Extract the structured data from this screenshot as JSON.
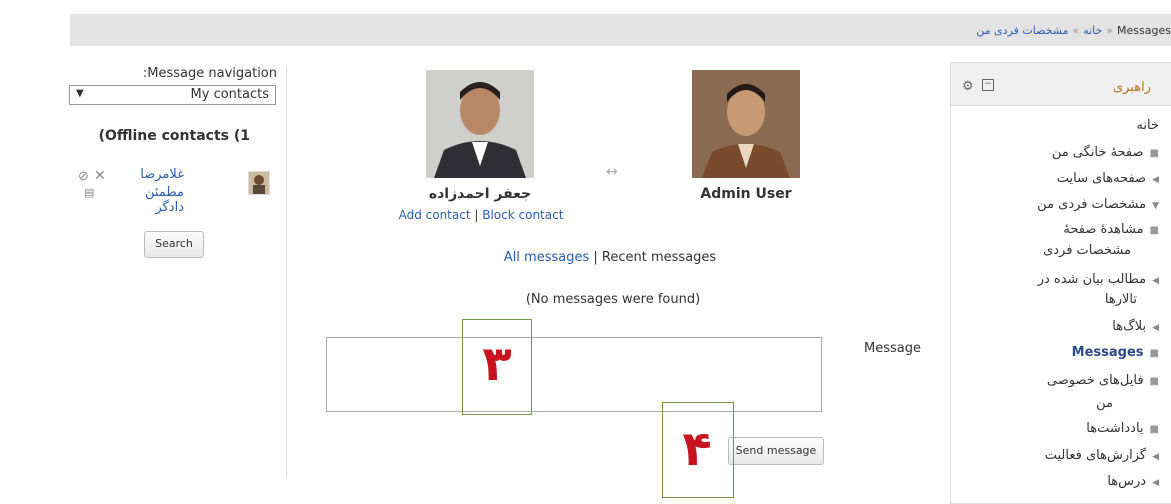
{
  "breadcrumb": {
    "items": [
      "خانه",
      "مشخصات فردی من",
      "Messages"
    ],
    "separator": "»"
  },
  "left_nav": {
    "title": ":Message navigation",
    "select_value": "My contacts",
    "offline_title": "(Offline contacts (1",
    "contact": {
      "name_line1": "غلامرضا",
      "name_line2": "مطمئن دادگر"
    },
    "search_button": "Search"
  },
  "center": {
    "user_jafar": "جعفر احمدزاده",
    "actions": {
      "add": "Add contact",
      "sep": "|",
      "block": "Block contact"
    },
    "user_admin": "Admin User",
    "links": {
      "all": "All messages",
      "sep": "|",
      "recent": "Recent messages"
    },
    "no_messages": "(No messages were found)",
    "message_label": "Message",
    "send_button": "Send message",
    "annotations": [
      "۳",
      "۴"
    ]
  },
  "block": {
    "title": "راهبری",
    "items": [
      "خانه",
      "صفحهٔ خانگی من",
      "صفحه‌های سایت",
      "مشخصات فردی من",
      "مشاهدهٔ صفحهٔ",
      "مشخصات فردی",
      "مطالب بیان شده در",
      "تالارها",
      "بلاگ‌ها",
      "Messages",
      "فایل‌های خصوصی",
      "من",
      "یادداشت‌ها",
      "گزارش‌های فعالیت",
      "درس‌ها"
    ]
  },
  "colors": {
    "link": "#2a5db0",
    "annotation_red": "#c8141e",
    "annotation_box": "#6f9a42",
    "block_title": "#b5741a"
  }
}
